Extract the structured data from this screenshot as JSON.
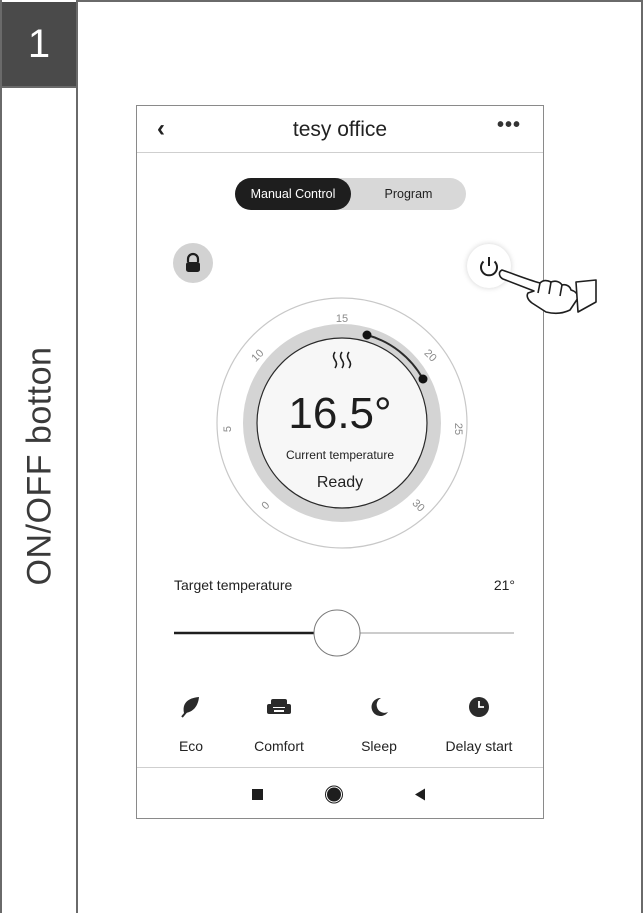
{
  "step": {
    "number": "1",
    "title": "ON/OFF botton"
  },
  "app": {
    "back_icon": "back-chevron",
    "title": "tesy office",
    "more_icon": "more-dots"
  },
  "control_tabs": [
    {
      "label": "Manual Control",
      "active": true
    },
    {
      "label": "Program",
      "active": false
    }
  ],
  "buttons": {
    "lock_icon": "lock-icon",
    "power_icon": "power-icon"
  },
  "dial": {
    "scale_labels": [
      "0",
      "5",
      "10",
      "15",
      "20",
      "25",
      "30"
    ],
    "heating_icon": "heat-waves-icon",
    "current_temperature": "16.5°",
    "caption": "Current temperature",
    "status": "Ready"
  },
  "target": {
    "label": "Target temperature",
    "value": "21°",
    "slider_fraction": 0.48
  },
  "modes": [
    {
      "label": "Eco",
      "icon": "leaf-icon"
    },
    {
      "label": "Comfort",
      "icon": "sofa-icon"
    },
    {
      "label": "Sleep",
      "icon": "moon-icon"
    },
    {
      "label": "Delay start",
      "icon": "clock-icon"
    }
  ],
  "system_nav": [
    "recents-square",
    "home-circle",
    "back-triangle"
  ],
  "colors": {
    "dark": "#1e1e1e",
    "ring": "#c8c8c8",
    "segment_bg": "#d8d8d8"
  }
}
